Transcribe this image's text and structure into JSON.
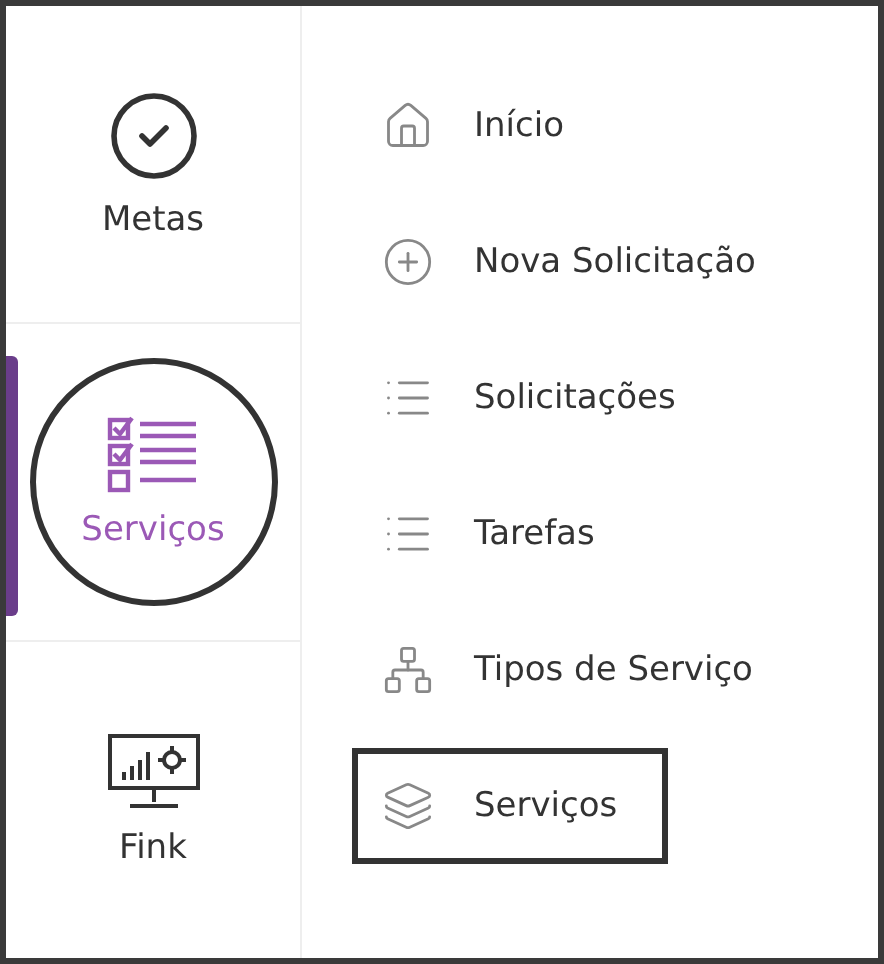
{
  "rail": [
    {
      "label": "Metas",
      "kind": "goal",
      "selected": false
    },
    {
      "label": "Serviços",
      "kind": "checklist",
      "selected": true
    },
    {
      "label": "Fink",
      "kind": "monitor",
      "selected": false
    }
  ],
  "menu": [
    {
      "label": "Início",
      "kind": "home",
      "selected": false
    },
    {
      "label": "Nova Solicitação",
      "kind": "add",
      "selected": false
    },
    {
      "label": "Solicitações",
      "kind": "list",
      "selected": false
    },
    {
      "label": "Tarefas",
      "kind": "list",
      "selected": false
    },
    {
      "label": "Tipos de Serviço",
      "kind": "hierarchy",
      "selected": false
    },
    {
      "label": "Serviços",
      "kind": "layers",
      "selected": true
    }
  ]
}
